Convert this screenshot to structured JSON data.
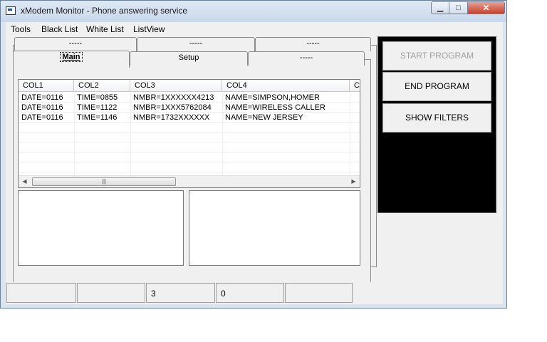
{
  "window": {
    "title": "xModem Monitor - Phone answering service"
  },
  "controls": {
    "minimize": "▁",
    "maximize": "□",
    "close": "✕"
  },
  "menu": [
    "Tools",
    "Black List",
    "White List",
    "ListView"
  ],
  "tabs": {
    "row1": [
      "-----",
      "-----",
      "-----"
    ],
    "row2": [
      "Main",
      "Setup",
      "-----"
    ],
    "active": "Main"
  },
  "listview": {
    "columns": [
      "COL1",
      "COL2",
      "COL3",
      "COL4",
      "CO"
    ],
    "rows": [
      [
        "DATE=0116",
        "TIME=0855",
        "NMBR=1XXXXXX4213",
        "NAME=SIMPSON,HOMER"
      ],
      [
        "DATE=0116",
        "TIME=1122",
        "NMBR=1XXX5762084",
        "NAME=WIRELESS CALLER"
      ],
      [
        "DATE=0116",
        "TIME=1146",
        "NMBR=1732XXXXXX",
        "NAME=NEW JERSEY"
      ]
    ],
    "scroll_left": "◀",
    "scroll_right": "▶",
    "scroll_thumb_grip": "|||"
  },
  "buttons": {
    "start": "START PROGRAM",
    "end": "END PROGRAM",
    "filters": "SHOW FILTERS"
  },
  "statusbar": [
    "",
    "",
    "3",
    "0",
    ""
  ],
  "colors": {
    "panel": "#000000",
    "face": "#f0f0f0",
    "frame": "#d9e4f1",
    "close": "#c5402b"
  }
}
